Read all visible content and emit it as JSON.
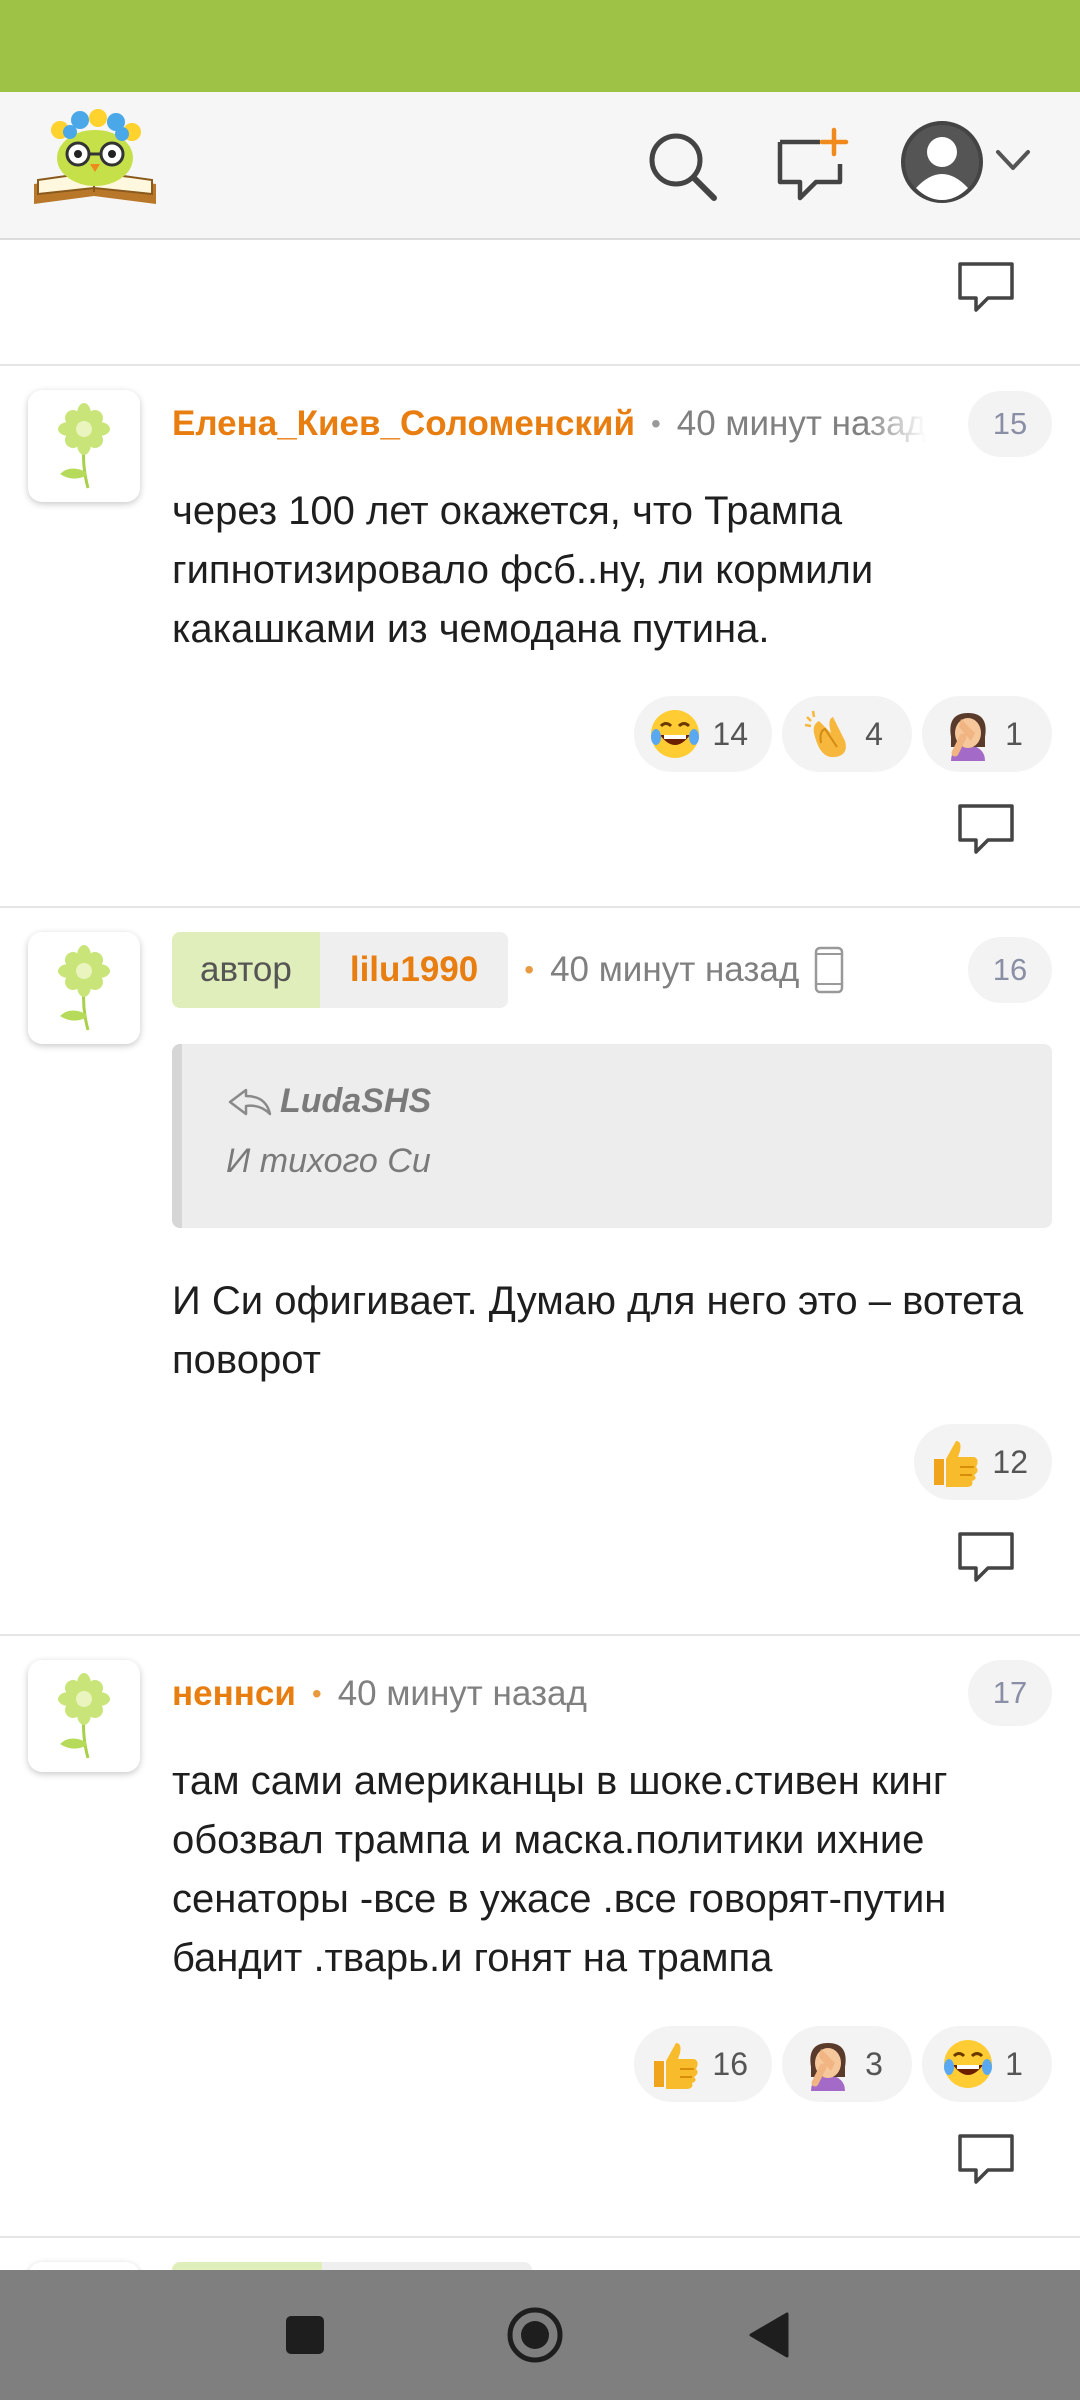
{
  "header": {
    "logo_icon": "owl-on-book-logo",
    "search_icon": "search-icon",
    "compose_icon": "new-comment-icon",
    "profile_icon": "user-avatar-icon",
    "menu_icon": "chevron-down-icon"
  },
  "comments": [
    {
      "username": "Елена_Киев_Соломенский",
      "time": "40 минут назад",
      "number": "15",
      "text": "через 100 лет окажется, что Трампа гипнотизировало фсб..ну, ли кормили какашками из чемодана путина.",
      "reactions": [
        {
          "emoji": "laughing-tears-emoji",
          "count": "14"
        },
        {
          "emoji": "clapping-hands-emoji",
          "count": "4"
        },
        {
          "emoji": "facepalm-emoji",
          "count": "1"
        }
      ]
    },
    {
      "author_label": "автор",
      "username": "lilu1990",
      "time": "40 минут назад",
      "number": "16",
      "quote_author": "LudaSHS",
      "quote_text": "И тихого Си",
      "text": "И Си офигивает. Думаю для него это – вотета поворот",
      "reactions": [
        {
          "emoji": "thumbs-up-emoji",
          "count": "12"
        }
      ]
    },
    {
      "username": "неннси",
      "time": "40 минут назад",
      "number": "17",
      "text": "там сами американцы в шоке.стивен кинг обозвал трампа и маска.политики ихние сенаторы -все в ужасе .все говорят-путин бандит .тварь.и гонят на трампа",
      "reactions": [
        {
          "emoji": "thumbs-up-emoji",
          "count": "16"
        },
        {
          "emoji": "facepalm-emoji",
          "count": "3"
        },
        {
          "emoji": "laughing-tears-emoji",
          "count": "1"
        }
      ]
    }
  ],
  "navigation": {
    "recents_icon": "square-recents-icon",
    "home_icon": "circle-home-icon",
    "back_icon": "triangle-back-icon"
  },
  "colors": {
    "accent_green": "#9dc246",
    "username_orange": "#e87d10",
    "nav_gray": "#7f7f7f"
  }
}
